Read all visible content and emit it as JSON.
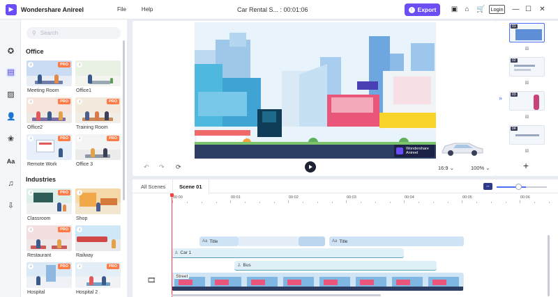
{
  "app": {
    "name": "Wondershare Anireel",
    "document_title": "Car Rental S... : 00:01:06",
    "menu": [
      "File",
      "Help"
    ],
    "export_label": "Export",
    "login_label": "Login"
  },
  "library": {
    "search_placeholder": "Search",
    "sections": [
      {
        "title": "Office",
        "items": [
          {
            "label": "Meeting Room",
            "pro": "PRO"
          },
          {
            "label": "Office1",
            "pro": ""
          },
          {
            "label": "Office2",
            "pro": "PRO"
          },
          {
            "label": "Training Room",
            "pro": "PRO"
          },
          {
            "label": "Remote Work",
            "pro": "PRO"
          },
          {
            "label": "Office 3",
            "pro": "PRO"
          }
        ]
      },
      {
        "title": "Industries",
        "items": [
          {
            "label": "Classroom",
            "pro": "PRO"
          },
          {
            "label": "Shop",
            "pro": ""
          },
          {
            "label": "Restaurant",
            "pro": "PRO"
          },
          {
            "label": "Railway",
            "pro": ""
          },
          {
            "label": "Hospital",
            "pro": "PRO"
          },
          {
            "label": "Hospital 2",
            "pro": "PRO"
          }
        ]
      }
    ]
  },
  "stage": {
    "watermark_line1": "Wondershare",
    "watermark_line2": "Anireel",
    "aspect_ratio": "16:9",
    "zoom": "100%"
  },
  "scenes": [
    "01",
    "02",
    "03",
    "04"
  ],
  "timeline": {
    "tabs": [
      "All Scenes",
      "Scene 01"
    ],
    "ruler": [
      "00:00",
      "00:01",
      "00:02",
      "00:03",
      "00:04",
      "00:05",
      "00:06"
    ],
    "tracks": {
      "title": "Title",
      "car": "Car 1",
      "bus": "Bus",
      "background": "Street"
    }
  },
  "colors": {
    "accent": "#6d4ef2",
    "playhead": "#ff3b3b",
    "pro_badge": "#ff7a45"
  }
}
